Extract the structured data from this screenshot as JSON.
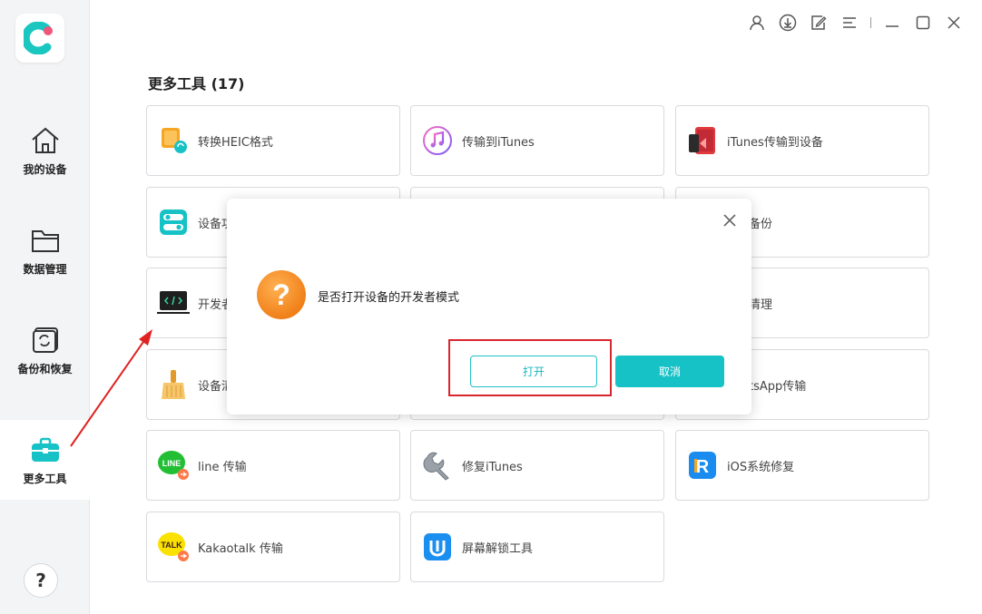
{
  "app": {
    "logo_icon": "app-logo-icon",
    "accent_color": "#17c2c7"
  },
  "sidebar": {
    "items": [
      {
        "label": "我的设备",
        "icon": "home-icon"
      },
      {
        "label": "数据管理",
        "icon": "folder-icon"
      },
      {
        "label": "备份和恢复",
        "icon": "backup-restore-icon"
      },
      {
        "label": "更多工具",
        "icon": "toolbox-icon",
        "active": true
      }
    ],
    "help_label": "?"
  },
  "titlebar": {
    "icons": [
      "user-icon",
      "download-icon",
      "edit-icon",
      "menu-icon",
      "minimize-icon",
      "maximize-icon",
      "close-icon"
    ]
  },
  "main": {
    "title": "更多工具 (17)",
    "tools": [
      {
        "label": "转换HEIC格式",
        "icon": "heic-convert-icon"
      },
      {
        "label": "传输到iTunes",
        "icon": "itunes-icon"
      },
      {
        "label": "iTunes传输到设备",
        "icon": "phone-transfer-icon"
      },
      {
        "label": "设备功",
        "icon": "toggle-settings-icon"
      },
      {
        "label": "",
        "icon": ""
      },
      {
        "label": "备份",
        "icon": ""
      },
      {
        "label": "开发者",
        "icon": "developer-icon"
      },
      {
        "label": "",
        "icon": ""
      },
      {
        "label": "清理",
        "icon": ""
      },
      {
        "label": "设备清",
        "icon": "broom-icon"
      },
      {
        "label": "",
        "icon": ""
      },
      {
        "label": "tsApp传输",
        "icon": ""
      },
      {
        "label": "line 传输",
        "icon": "line-icon"
      },
      {
        "label": "修复iTunes",
        "icon": "wrench-icon"
      },
      {
        "label": "iOS系统修复",
        "icon": "reiboot-icon"
      },
      {
        "label": "Kakaotalk 传输",
        "icon": "kakaotalk-icon"
      },
      {
        "label": "屏幕解锁工具",
        "icon": "unlock-icon"
      }
    ]
  },
  "dialog": {
    "message": "是否打开设备的开发者模式",
    "icon": "question-icon",
    "open_label": "打开",
    "cancel_label": "取消"
  }
}
